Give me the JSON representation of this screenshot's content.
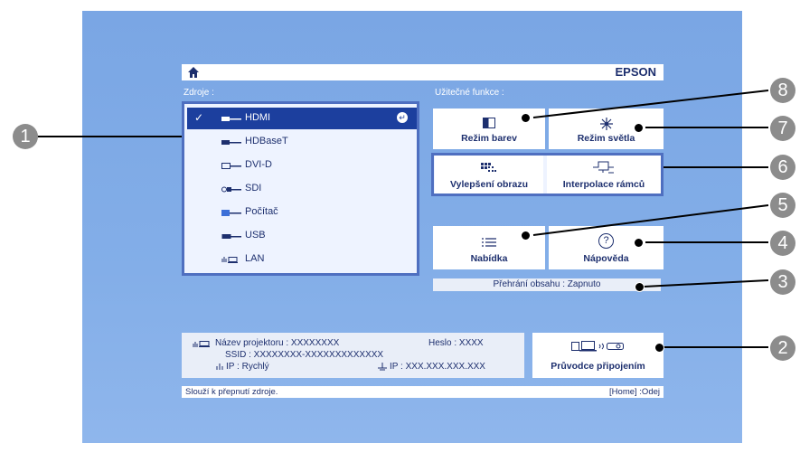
{
  "topbar": {
    "brand": "EPSON"
  },
  "sources_label": "Zdroje :",
  "features_label": "Užitečné funkce :",
  "sources": [
    {
      "label": "HDMI",
      "selected": true,
      "icon": "hdmi-icon"
    },
    {
      "label": "HDBaseT",
      "selected": false,
      "icon": "hdbaset-icon"
    },
    {
      "label": "DVI-D",
      "selected": false,
      "icon": "dvi-icon"
    },
    {
      "label": "SDI",
      "selected": false,
      "icon": "sdi-icon"
    },
    {
      "label": "Počítač",
      "selected": false,
      "icon": "computer-icon"
    },
    {
      "label": "USB",
      "selected": false,
      "icon": "usb-icon"
    },
    {
      "label": "LAN",
      "selected": false,
      "icon": "lan-icon"
    }
  ],
  "source_check": "✓",
  "source_enter": "↵",
  "tiles": {
    "color_mode": "Režim barev",
    "light_mode": "Režim světla",
    "image_enhance": "Vylepšení obrazu",
    "frame_interp": "Interpolace rámců",
    "menu": "Nabídka",
    "help": "Nápověda",
    "help_symbol": "?"
  },
  "playback": "Přehrání obsahu : Zapnuto",
  "info": {
    "projector_name": "Název projektoru : XXXXXXXX",
    "password": "Heslo : XXXX",
    "ssid": "SSID : XXXXXXXX-XXXXXXXXXXXXX",
    "wireless_ip": "IP : Rychlý",
    "wired_ip": "IP : XXX.XXX.XXX.XXX"
  },
  "wizard": "Průvodce připojením",
  "status": {
    "left": "Slouží k přepnutí zdroje.",
    "right": "[Home] :Odej"
  },
  "callouts": [
    "1",
    "2",
    "3",
    "4",
    "5",
    "6",
    "7",
    "8"
  ]
}
